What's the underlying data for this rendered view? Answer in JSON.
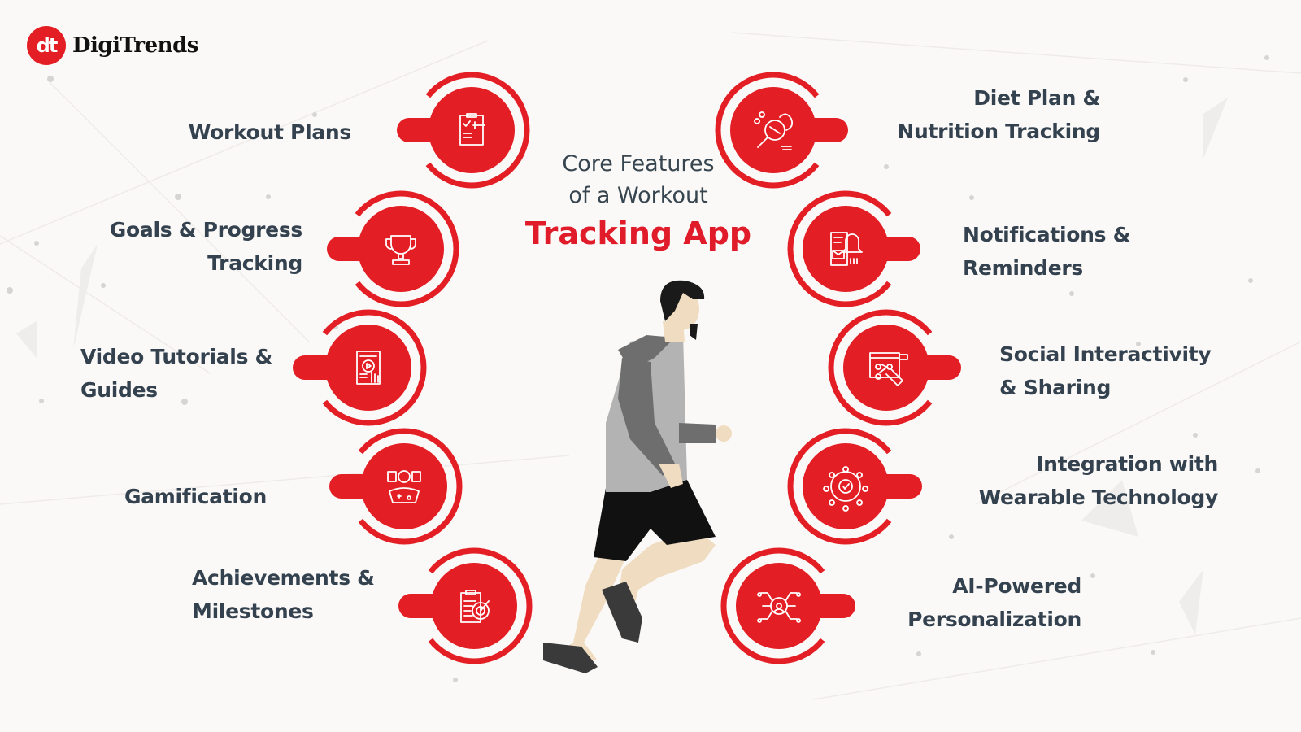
{
  "brand": {
    "logo_mark": "dt",
    "name": "DigiTrends",
    "accent_color": "#e31e24"
  },
  "title": {
    "line1": "Core Features",
    "line2": "of a Workout",
    "line3": "Tracking App",
    "text_color": "#36454f",
    "highlight_color": "#e01b2a"
  },
  "features_left": [
    {
      "label": "Workout Plans",
      "icon": "workout-clipboard-dumbbell-icon"
    },
    {
      "label": "Goals & Progress\nTracking",
      "icon": "trophy-target-icon"
    },
    {
      "label": "Video Tutorials &\nGuides",
      "icon": "tablet-video-tap-icon"
    },
    {
      "label": "Gamification",
      "icon": "game-controller-hands-icon"
    },
    {
      "label": "Achievements &\nMilestones",
      "icon": "clipboard-target-icon"
    }
  ],
  "features_right": [
    {
      "label": "Diet Plan &\nNutrition Tracking",
      "icon": "apple-magnifier-icon"
    },
    {
      "label": "Notifications  &\nReminders",
      "icon": "phone-bell-mail-icon"
    },
    {
      "label": "Social  Interactivity\n& Sharing",
      "icon": "network-hand-share-icon"
    },
    {
      "label": "Integration with\nWearable Technology",
      "icon": "gear-network-check-icon"
    },
    {
      "label": "AI-Powered\nPersonalization",
      "icon": "ai-circuit-user-icon"
    }
  ],
  "illustration": "runner-illustration"
}
